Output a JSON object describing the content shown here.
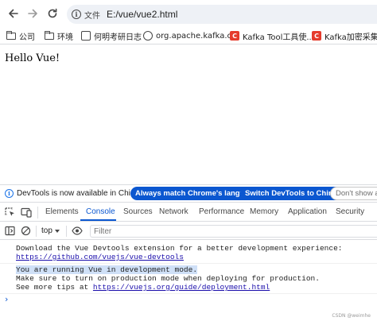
{
  "toolbar": {
    "site_info_label": "文件",
    "url": "E:/vue/vue2.html"
  },
  "bookmarks": [
    {
      "label": "公司",
      "icon": "folder-icon"
    },
    {
      "label": "环境",
      "icon": "folder-icon"
    },
    {
      "label": "何明考研日志",
      "icon": "page-icon"
    },
    {
      "label": "org.apache.kafka.c...",
      "icon": "globe-icon"
    },
    {
      "label": "Kafka Tool工具使...",
      "icon": "csdn-c-icon",
      "glyph": "C"
    },
    {
      "label": "Kafka加密采集监",
      "icon": "csdn-c-icon",
      "glyph": "C"
    }
  ],
  "page": {
    "text": "Hello Vue!"
  },
  "devtools": {
    "infobar": {
      "message": "DevTools is now available in Chinese!",
      "match_button": "Always match Chrome's language",
      "switch_button": "Switch DevTools to Chinese",
      "dismiss_button": "Don't show ag"
    },
    "tabs": [
      "Elements",
      "Console",
      "Sources",
      "Network",
      "Performance",
      "Memory",
      "Application",
      "Security"
    ],
    "active_tab": "Console",
    "context": "top",
    "filter_placeholder": "Filter",
    "console": {
      "line1": "Download the Vue Devtools extension for a better development experience:",
      "link1": "https://github.com/vuejs/vue-devtools",
      "line3": "You are running Vue in development mode.",
      "line4": "Make sure to turn on production mode when deploying for production.",
      "line5_prefix": "See more tips at ",
      "link2": "https://vuejs.org/guide/deployment.html",
      "prompt": "›"
    }
  },
  "watermark": "CSDN @weimhe",
  "colors": {
    "accent": "#0b57d0",
    "link": "#1a0dab",
    "highlight": "#cfe0f7",
    "csdn_red": "#e53b2c"
  }
}
